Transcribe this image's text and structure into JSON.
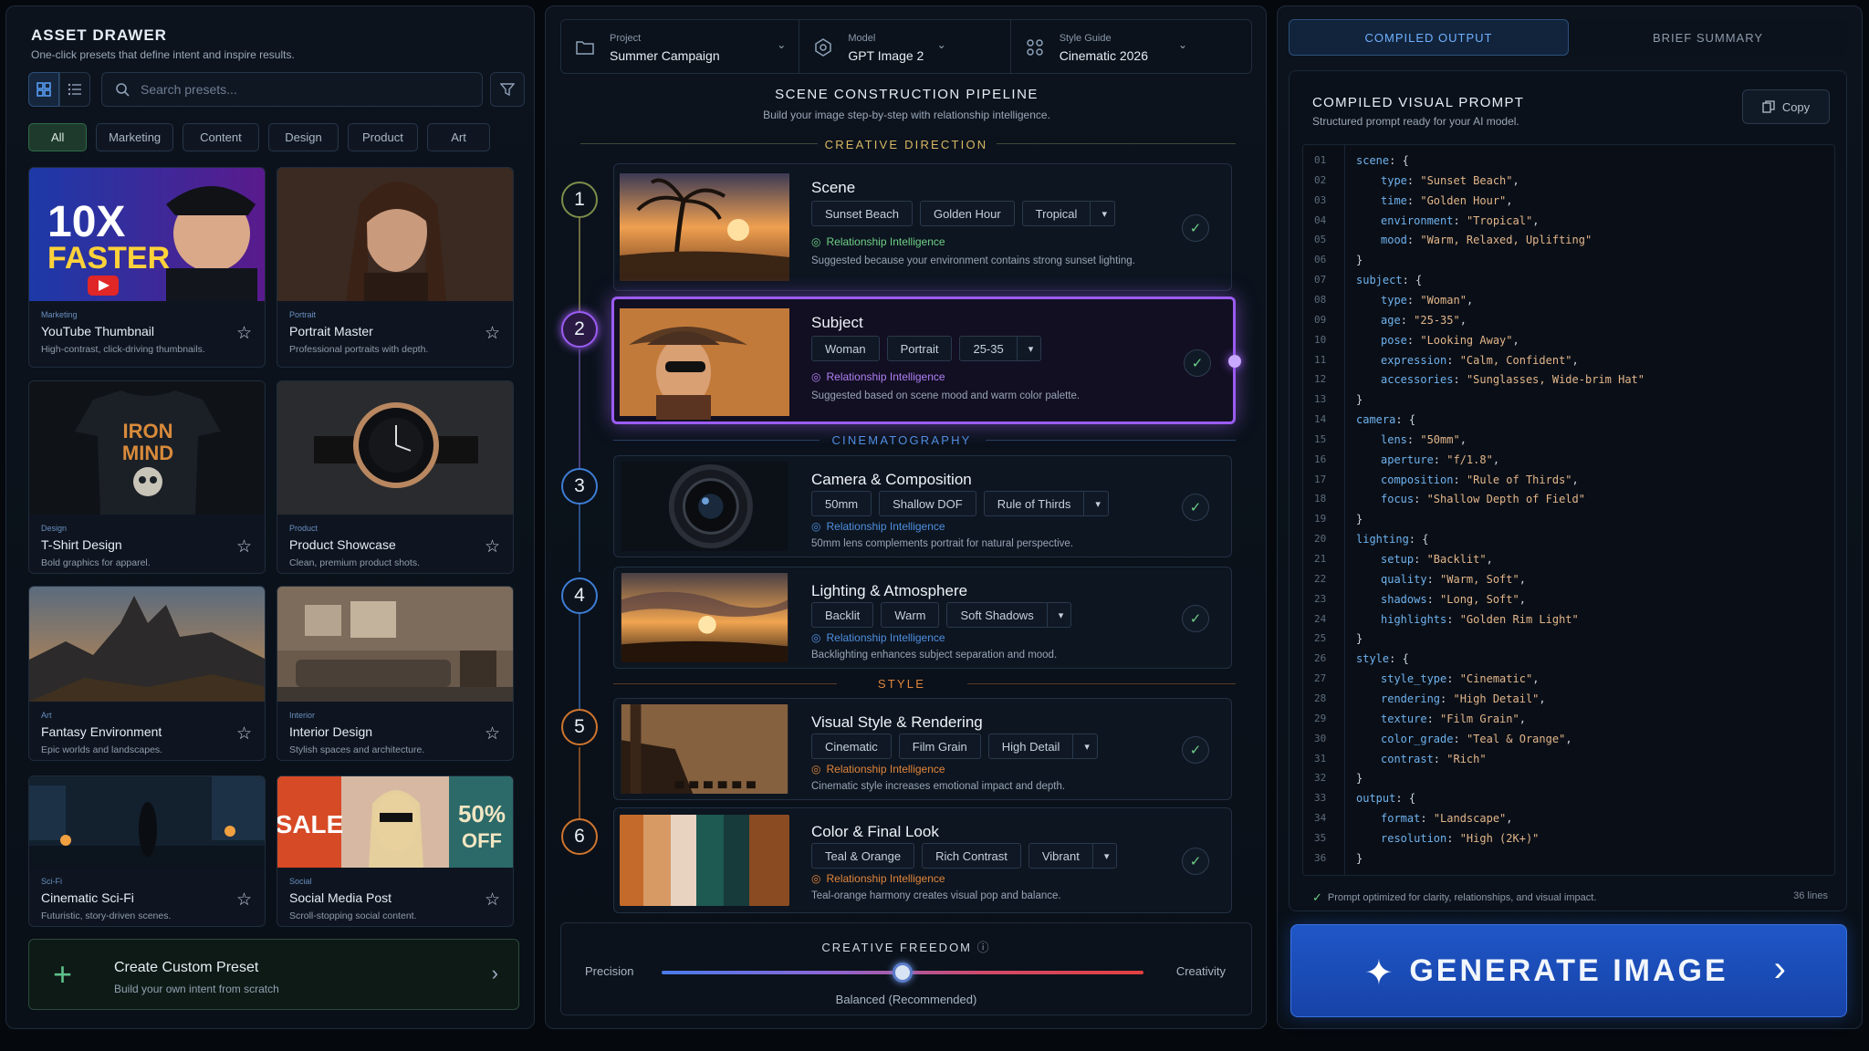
{
  "drawer": {
    "title": "ASSET DRAWER",
    "subtitle": "One-click presets that define intent and inspire results.",
    "search_placeholder": "Search presets...",
    "filters": [
      "All",
      "Marketing",
      "Content",
      "Design",
      "Product",
      "Art"
    ],
    "active_filter": "All",
    "cards": [
      {
        "category": "Marketing",
        "name": "YouTube Thumbnail",
        "desc": "High-contrast, click-driving thumbnails.",
        "overlay": [
          "10X",
          "FASTER"
        ]
      },
      {
        "category": "Portrait",
        "name": "Portrait Master",
        "desc": "Professional portraits with depth."
      },
      {
        "category": "Design",
        "name": "T-Shirt Design",
        "desc": "Bold graphics for apparel.",
        "overlay": [
          "IRON",
          "MIND"
        ]
      },
      {
        "category": "Product",
        "name": "Product Showcase",
        "desc": "Clean, premium product shots."
      },
      {
        "category": "Art",
        "name": "Fantasy Environment",
        "desc": "Epic worlds and landscapes."
      },
      {
        "category": "Interior",
        "name": "Interior Design",
        "desc": "Stylish spaces and architecture."
      },
      {
        "category": "Sci-Fi",
        "name": "Cinematic Sci-Fi",
        "desc": "Futuristic, story-driven scenes."
      },
      {
        "category": "Social",
        "name": "Social Media Post",
        "desc": "Scroll-stopping social content.",
        "overlay": [
          "SALE",
          "50%",
          "OFF"
        ]
      }
    ],
    "custom": {
      "title": "Create Custom Preset",
      "subtitle": "Build your own intent from scratch"
    }
  },
  "topbar": {
    "project": {
      "label": "Project",
      "value": "Summer Campaign"
    },
    "model": {
      "label": "Model",
      "value": "GPT Image 2"
    },
    "style": {
      "label": "Style Guide",
      "value": "Cinematic 2026"
    }
  },
  "pipeline": {
    "title": "SCENE CONSTRUCTION PIPELINE",
    "subtitle": "Build your image step-by-step with relationship intelligence.",
    "sections": {
      "creative": "CREATIVE DIRECTION",
      "cinema": "CINEMATOGRAPHY",
      "style": "STYLE"
    },
    "ri_label": "Relationship Intelligence",
    "steps": [
      {
        "num": "1",
        "title": "Scene",
        "tags": [
          "Sunset Beach",
          "Golden Hour",
          "Tropical"
        ],
        "note": "Suggested because your environment contains strong sunset lighting."
      },
      {
        "num": "2",
        "title": "Subject",
        "tags": [
          "Woman",
          "Portrait",
          "25-35"
        ],
        "note": "Suggested based on scene mood and warm color palette."
      },
      {
        "num": "3",
        "title": "Camera & Composition",
        "tags": [
          "50mm",
          "Shallow DOF",
          "Rule of Thirds"
        ],
        "note": "50mm lens complements portrait for natural perspective."
      },
      {
        "num": "4",
        "title": "Lighting & Atmosphere",
        "tags": [
          "Backlit",
          "Warm",
          "Soft Shadows"
        ],
        "note": "Backlighting enhances subject separation and mood."
      },
      {
        "num": "5",
        "title": "Visual Style & Rendering",
        "tags": [
          "Cinematic",
          "Film Grain",
          "High Detail"
        ],
        "note": "Cinematic style increases emotional impact and depth."
      },
      {
        "num": "6",
        "title": "Color & Final Look",
        "tags": [
          "Teal & Orange",
          "Rich Contrast",
          "Vibrant"
        ],
        "note": "Teal-orange harmony creates visual pop and balance."
      }
    ]
  },
  "freedom": {
    "title": "CREATIVE FREEDOM",
    "left": "Precision",
    "right": "Creativity",
    "value_label": "Balanced (Recommended)",
    "level": 0.5
  },
  "output": {
    "tabs": [
      "COMPILED OUTPUT",
      "BRIEF SUMMARY"
    ],
    "active_tab": "COMPILED OUTPUT",
    "title": "COMPILED VISUAL PROMPT",
    "subtitle": "Structured prompt ready for your AI model.",
    "copy": "Copy",
    "code": [
      [
        0,
        "scene",
        "{",
        ""
      ],
      [
        1,
        "type",
        "\"Sunset Beach\"",
        ","
      ],
      [
        1,
        "time",
        "\"Golden Hour\"",
        ","
      ],
      [
        1,
        "environment",
        "\"Tropical\"",
        ","
      ],
      [
        1,
        "mood",
        "\"Warm, Relaxed, Uplifting\"",
        ""
      ],
      [
        0,
        "",
        "}",
        ""
      ],
      [
        0,
        "subject",
        "{",
        ""
      ],
      [
        1,
        "type",
        "\"Woman\"",
        ","
      ],
      [
        1,
        "age",
        "\"25-35\"",
        ","
      ],
      [
        1,
        "pose",
        "\"Looking Away\"",
        ","
      ],
      [
        1,
        "expression",
        "\"Calm, Confident\"",
        ","
      ],
      [
        1,
        "accessories",
        "\"Sunglasses, Wide-brim Hat\"",
        ""
      ],
      [
        0,
        "",
        "}",
        ""
      ],
      [
        0,
        "camera",
        "{",
        ""
      ],
      [
        1,
        "lens",
        "\"50mm\"",
        ","
      ],
      [
        1,
        "aperture",
        "\"f/1.8\"",
        ","
      ],
      [
        1,
        "composition",
        "\"Rule of Thirds\"",
        ","
      ],
      [
        1,
        "focus",
        "\"Shallow Depth of Field\"",
        ""
      ],
      [
        0,
        "",
        "}",
        ""
      ],
      [
        0,
        "lighting",
        "{",
        ""
      ],
      [
        1,
        "setup",
        "\"Backlit\"",
        ","
      ],
      [
        1,
        "quality",
        "\"Warm, Soft\"",
        ","
      ],
      [
        1,
        "shadows",
        "\"Long, Soft\"",
        ","
      ],
      [
        1,
        "highlights",
        "\"Golden Rim Light\"",
        ""
      ],
      [
        0,
        "",
        "}",
        ""
      ],
      [
        0,
        "style",
        "{",
        ""
      ],
      [
        1,
        "style_type",
        "\"Cinematic\"",
        ","
      ],
      [
        1,
        "rendering",
        "\"High Detail\"",
        ","
      ],
      [
        1,
        "texture",
        "\"Film Grain\"",
        ","
      ],
      [
        1,
        "color_grade",
        "\"Teal & Orange\"",
        ","
      ],
      [
        1,
        "contrast",
        "\"Rich\"",
        ""
      ],
      [
        0,
        "",
        "}",
        ""
      ],
      [
        0,
        "output",
        "{",
        ""
      ],
      [
        1,
        "format",
        "\"Landscape\"",
        ","
      ],
      [
        1,
        "resolution",
        "\"High (2K+)\"",
        ""
      ],
      [
        0,
        "",
        "}",
        ""
      ]
    ],
    "footer": "Prompt optimized for clarity, relationships, and visual impact.",
    "line_count": "36 lines",
    "generate": "GENERATE IMAGE"
  },
  "colors": {
    "accent_blue": "#1f56c7",
    "creative": "#d8b862",
    "cinema": "#4f8fe0",
    "style": "#e0853a",
    "selected": "#9b5cf2",
    "check": "#6fcf86"
  }
}
